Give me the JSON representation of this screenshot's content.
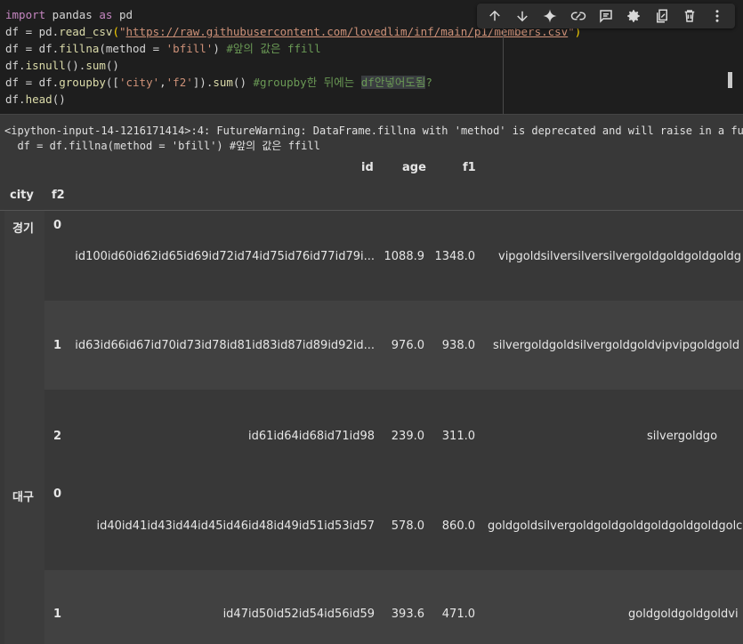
{
  "code": {
    "l1_a": "import",
    "l1_b": " pandas ",
    "l1_c": "as",
    "l1_d": " pd",
    "l2_a": "df = pd.",
    "l2_fn": "read_csv",
    "l2_p1": "(",
    "l2_q1": "\"",
    "l2_url": "https://raw.githubusercontent.com/lovedlim/inf/main/p1/members.csv",
    "l2_q2": "\"",
    "l2_p2": ")",
    "l3_a": "df = df.",
    "l3_fn": "fillna",
    "l3_b": "(method = ",
    "l3_str": "'bfill'",
    "l3_c": ") ",
    "l3_cm": "#앞의 값은 ffill",
    "l4_a": "df.",
    "l4_fn": "isnull",
    "l4_b": "().",
    "l4_fn2": "sum",
    "l4_c": "()",
    "l5_a": "df = df.",
    "l5_fn": "groupby",
    "l5_b": "([",
    "l5_s1": "'city'",
    "l5_c": ",",
    "l5_s2": "'f2'",
    "l5_d": "]).",
    "l5_fn2": "sum",
    "l5_e": "() ",
    "l5_cm": "#groupby한 뒤에는 ",
    "l5_hl": "df안넣어도됨",
    "l5_cm2": "?",
    "l6_a": "df.",
    "l6_fn": "head",
    "l6_b": "()"
  },
  "toolbar": {
    "icons": [
      "arrow-up-icon",
      "arrow-down-icon",
      "sparkle-icon",
      "link-icon",
      "comment-icon",
      "gear-icon",
      "mirror-cell-icon",
      "trash-icon",
      "more-vert-icon"
    ]
  },
  "output": {
    "warning_line1": "<ipython-input-14-1216171414>:4: FutureWarning: DataFrame.fillna with 'method' is deprecated and will raise in a future",
    "warning_line2": "  df = df.fillna(method = 'bfill') #앞의 값은 ffill",
    "columns": [
      "id",
      "age",
      "f1"
    ],
    "index_names": [
      "city",
      "f2"
    ],
    "cities": [
      "경기",
      "대구"
    ],
    "rows": [
      {
        "f2": "0",
        "id": "id100id60id62id65id69id72id74id75id76id77id79i...",
        "age": "1088.9",
        "f1": "1348.0",
        "f3": "vipgoldsilversilversilvergoldgoldgoldgoldg"
      },
      {
        "f2": "1",
        "id": "id63id66id67id70id73id78id81id83id87id89id92id...",
        "age": "976.0",
        "f1": "938.0",
        "f3": "silvergoldgoldsilvergoldgoldvipvipgoldgold"
      },
      {
        "f2": "2",
        "id": "id61id64id68id71id98",
        "age": "239.0",
        "f1": "311.0",
        "f3": "silvergoldgo"
      },
      {
        "f2": "0",
        "id": "id40id41id43id44id45id46id48id49id51id53id57",
        "age": "578.0",
        "f1": "860.0",
        "f3": "goldgoldsilvergoldgoldgoldgoldgoldgoldgolc"
      },
      {
        "f2": "1",
        "id": "id47id50id52id54id56id59",
        "age": "393.6",
        "f1": "471.0",
        "f3": "goldgoldgoldgoldvi"
      }
    ]
  }
}
